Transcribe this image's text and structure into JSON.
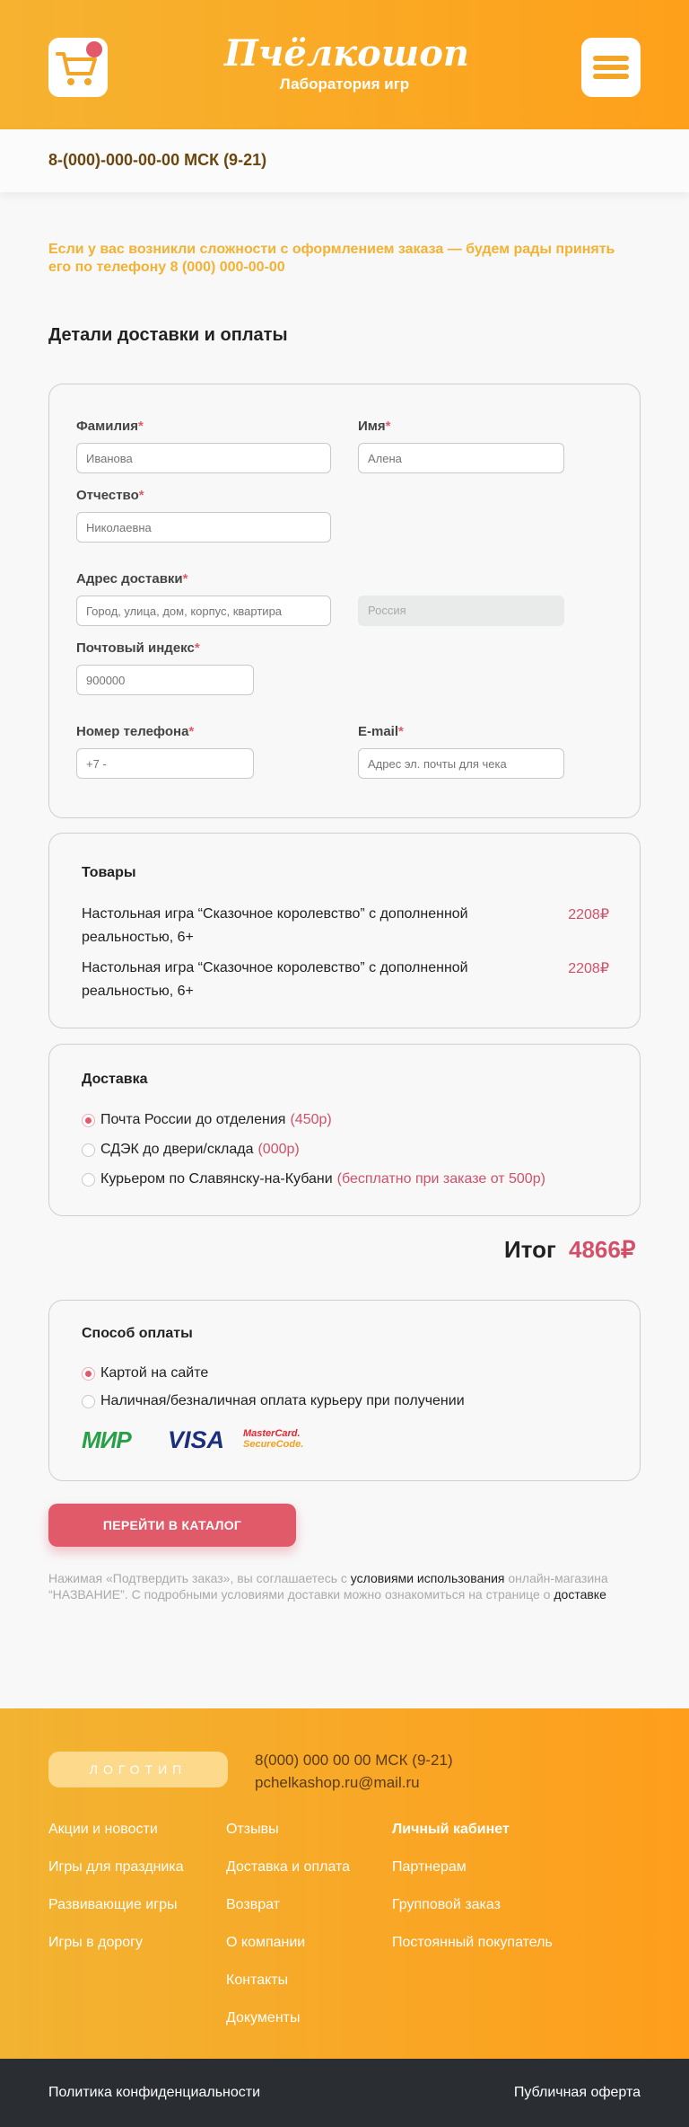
{
  "header": {
    "logo_title": "Пчёлкошоп",
    "logo_subtitle": "Лаборатория игр",
    "phone": "8-(000)-000-00-00 МСК (9-21)"
  },
  "notice": "Если у вас возникли сложности с оформлением заказа — будем рады принять его по телефону 8 (000) 000-00-00",
  "section_title": "Детали доставки и оплаты",
  "form": {
    "last_name": {
      "label": "Фамилия",
      "placeholder": "Иванова"
    },
    "first_name": {
      "label": "Имя",
      "placeholder": "Алена"
    },
    "patronymic": {
      "label": "Отчество",
      "placeholder": "Николаевна"
    },
    "address": {
      "label": "Адрес доставки",
      "placeholder": "Город, улица, дом, корпус, квартира"
    },
    "country": {
      "value": "Россия"
    },
    "postcode": {
      "label": "Почтовый индекс",
      "placeholder": "900000"
    },
    "phone": {
      "label": "Номер телефона",
      "placeholder": "+7 -"
    },
    "email": {
      "label": "E-mail",
      "placeholder": "Адрес эл. почты для чека"
    },
    "required_mark": "*"
  },
  "goods": {
    "title": "Товары",
    "items": [
      {
        "name": "Настольная игра “Сказочное королевство” с дополненной реальностью, 6+",
        "price": "2208₽"
      },
      {
        "name": "Настольная игра “Сказочное королевство” с дополненной реальностью, 6+",
        "price": "2208₽"
      }
    ]
  },
  "delivery": {
    "title": "Доставка",
    "options": [
      {
        "label": "Почта России до отделения",
        "price": "(450р)",
        "selected": true
      },
      {
        "label": "СДЭК до двери/склада",
        "price": "(000р)",
        "selected": false
      },
      {
        "label": "Курьером по Славянску-на-Кубани",
        "price": "(бесплатно при заказе от 500р)",
        "selected": false
      }
    ]
  },
  "total": {
    "label": "Итог",
    "value": "4866₽"
  },
  "payment": {
    "title": "Способ оплаты",
    "options": [
      {
        "label": "Картой на сайте",
        "selected": true
      },
      {
        "label": "Наличная/безналичная оплата курьеру при получении",
        "selected": false
      }
    ],
    "logos": {
      "mir": "МИР",
      "visa": "VISA",
      "mastercard_line1": "MasterCard.",
      "mastercard_line2": "SecureCode."
    }
  },
  "catalog_button": "ПЕРЕЙТИ В КАТАЛОГ",
  "legal": {
    "part1": "Нажимая «Подтвердить заказ», вы соглашаетесь с ",
    "link1": "условиями использования",
    "part2": " онлайн-магазина “НАЗВАНИЕ”. С подробными условиями доставки можно ознакомиться на странице о ",
    "link2": "доставке"
  },
  "footer": {
    "logo": "ЛОГОТИП",
    "phone": "8(000) 000 00 00 МСК (9-21)",
    "email": "pchelkashop.ru@mail.ru",
    "col1": [
      "Акции и новости",
      "Игры для праздника",
      "Развивающие игры",
      "Игры в дорогу"
    ],
    "col2": [
      "Отзывы",
      "Доставка и оплата",
      "Возврат",
      "О компании",
      "Контакты",
      "Документы"
    ],
    "col3": [
      "Личный кабинет",
      "Партнерам",
      "Групповой заказ",
      "Постоянный покупатель"
    ],
    "privacy": "Политика конфиденциальности",
    "offer": "Публичная оферта"
  },
  "colors": {
    "accent": "#e05a6a",
    "brand_orange": "#fea01a",
    "brand_yellow": "#f6b330"
  }
}
